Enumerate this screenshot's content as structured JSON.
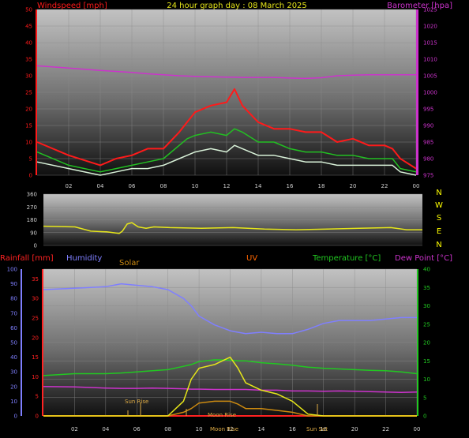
{
  "colors": {
    "background": "#000000",
    "wind_speed": "#ff1a1a",
    "wind_gust": "#22c022",
    "wind_avg": "#d9f2d9",
    "barometer": "#cc33cc",
    "direction": "#e6e61a",
    "rainfall": "#ff2222",
    "humidity": "#7f7fff",
    "solar": "#cc8a10",
    "uv": "#ff6600",
    "temperature": "#21c821",
    "dew_point": "#cc33cc",
    "direction_letters": "#ffff00",
    "astro_labels": "#ddaa44"
  },
  "header": {
    "title": "24 hour graph day : 08 March 2025",
    "wind_label": "Windspeed [mph]",
    "baro_label": "Barometer [hpa]"
  },
  "panel2": {
    "direction_letters": [
      "N",
      "W",
      "S",
      "E",
      "N"
    ]
  },
  "panel3_labels": {
    "rainfall": "Rainfall [mm]",
    "humidity": "Humidity",
    "solar": "Solar",
    "uv": "UV",
    "temperature": "Temperature [°C]",
    "dew_point": "Dew Point [°C]"
  },
  "astro": {
    "sun_rise": "Sun Rise",
    "sun_set": "Sun Set",
    "moon_rise": "Moon Rise",
    "moon_rise_bottom": "Moon Rise"
  },
  "chart_data": [
    {
      "type": "line",
      "x_ticks": [
        "02",
        "04",
        "06",
        "08",
        "10",
        "12",
        "14",
        "16",
        "18",
        "20",
        "22",
        "00"
      ],
      "x_unit": "hour",
      "x": [
        0,
        2,
        4,
        5,
        6,
        7,
        8,
        9,
        9.5,
        10,
        11,
        12,
        12.5,
        13,
        14,
        15,
        16,
        17,
        18,
        19,
        20,
        21,
        22,
        22.5,
        23,
        24
      ],
      "y_left_ticks": [
        "0",
        "5",
        "10",
        "15",
        "20",
        "25",
        "30",
        "35",
        "40",
        "45",
        "50"
      ],
      "ylim_left": [
        0,
        50
      ],
      "y_right_ticks": [
        "975",
        "980",
        "985",
        "990",
        "995",
        "1000",
        "1005",
        "1010",
        "1015",
        "1020",
        "1025"
      ],
      "ylim_right": [
        975,
        1025
      ],
      "series": [
        {
          "name": "Windspeed [mph]",
          "axis": "left",
          "values": [
            10,
            6,
            3,
            5,
            6,
            8,
            8,
            13,
            16,
            19,
            21,
            22,
            26,
            21,
            16,
            14,
            14,
            13,
            13,
            10,
            11,
            9,
            9,
            8,
            5,
            2
          ]
        },
        {
          "axis": "left",
          "values": [
            7,
            3,
            1,
            2,
            3,
            4,
            5,
            9,
            11,
            12,
            13,
            12,
            14,
            13,
            10,
            10,
            8,
            7,
            7,
            6,
            6,
            5,
            5,
            5,
            2,
            1
          ]
        },
        {
          "axis": "left",
          "values": [
            4,
            2,
            0,
            1,
            2,
            2,
            3,
            5,
            6,
            7,
            8,
            7,
            9,
            8,
            6,
            6,
            5,
            4,
            4,
            3,
            3,
            3,
            3,
            3,
            1,
            0
          ]
        },
        {
          "name": "Barometer [hpa]",
          "axis": "right",
          "values": [
            1008,
            1007.3,
            1006.6,
            1006.3,
            1006,
            1005.6,
            1005.3,
            1005,
            1004.9,
            1004.8,
            1004.7,
            1004.6,
            1004.6,
            1004.5,
            1004.5,
            1004.5,
            1004.3,
            1004.2,
            1004.4,
            1005,
            1005.2,
            1005.3,
            1005.3,
            1005.3,
            1005.3,
            1005.3
          ]
        }
      ]
    },
    {
      "type": "line",
      "x": [
        0,
        2,
        3,
        4,
        4.8,
        5,
        5.3,
        5.6,
        6,
        6.5,
        7,
        8,
        10,
        12,
        14,
        16,
        18,
        20,
        22,
        23,
        24
      ],
      "ylim": [
        0,
        360
      ],
      "y_ticks": [
        "0",
        "90",
        "180",
        "270",
        "360"
      ],
      "series": [
        {
          "name": "Wind Direction",
          "values": [
            135,
            130,
            100,
            95,
            85,
            100,
            150,
            160,
            130,
            120,
            130,
            125,
            120,
            125,
            115,
            110,
            115,
            120,
            125,
            110,
            110
          ]
        }
      ]
    },
    {
      "type": "line",
      "x_ticks": [
        "02",
        "04",
        "06",
        "08",
        "10",
        "12",
        "14",
        "16",
        "18",
        "20",
        "22",
        "00"
      ],
      "x_unit": "hour",
      "x": [
        0,
        2,
        4,
        5,
        6,
        7,
        8,
        9,
        9.5,
        10,
        11,
        12,
        12.5,
        13,
        14,
        15,
        16,
        17,
        18,
        19,
        20,
        21,
        22,
        23,
        24
      ],
      "y_humidity_ticks": [
        "0",
        "10",
        "20",
        "30",
        "40",
        "50",
        "60",
        "70",
        "80",
        "90",
        "100"
      ],
      "ylim_humidity": [
        0,
        100
      ],
      "y_rain_ticks": [
        "0",
        "5",
        "10",
        "15",
        "20",
        "25",
        "30",
        "35"
      ],
      "ylim_rain": [
        0,
        37.5
      ],
      "y_temp_ticks": [
        "0",
        "5",
        "10",
        "15",
        "20",
        "25",
        "30",
        "35",
        "40"
      ],
      "ylim_temp": [
        0,
        40
      ],
      "series": [
        {
          "name": "Humidity",
          "axis": "humidity",
          "values": [
            86,
            87,
            88,
            90,
            89,
            88,
            86,
            80,
            75,
            68,
            62,
            58,
            57,
            56,
            57,
            56,
            56,
            59,
            63,
            65,
            65,
            65,
            66,
            67,
            67
          ]
        },
        {
          "name": "Rainfall [mm]",
          "axis": "rain",
          "values": [
            0,
            0,
            0,
            0,
            0,
            0,
            0,
            0,
            0,
            0,
            0,
            0,
            0,
            0,
            0,
            0,
            0,
            0,
            0,
            0,
            0,
            0,
            0,
            0,
            0
          ]
        },
        {
          "name": "Temperature [°C]",
          "axis": "temp",
          "values": [
            11,
            11.5,
            11.5,
            11.7,
            12,
            12.3,
            12.6,
            13.5,
            14,
            14.8,
            15.3,
            15.2,
            15,
            15,
            14.5,
            14.2,
            13.8,
            13.3,
            13,
            12.8,
            12.6,
            12.4,
            12.3,
            12,
            11.5
          ]
        },
        {
          "name": "Dew Point [°C]",
          "axis": "temp",
          "values": [
            8,
            7.9,
            7.6,
            7.5,
            7.5,
            7.6,
            7.5,
            7.4,
            7.3,
            7.3,
            7.2,
            7.2,
            7.2,
            7.2,
            7,
            7,
            6.8,
            6.8,
            6.7,
            6.8,
            6.7,
            6.6,
            6.5,
            6.4,
            6.5
          ]
        },
        {
          "name": "Solar",
          "axis": "temp",
          "values": [
            0,
            0,
            0,
            0,
            0,
            0,
            0,
            1,
            2,
            3.5,
            4,
            4,
            3.2,
            2,
            2,
            1.5,
            1,
            0,
            0,
            0,
            0,
            0,
            0,
            0,
            0
          ]
        },
        {
          "name": "UV",
          "axis": "temp",
          "values": [
            0,
            0,
            0,
            0,
            0,
            0,
            0,
            4,
            10,
            13,
            14,
            16,
            13,
            9,
            7,
            6,
            4,
            0.5,
            0,
            0,
            0,
            0,
            0,
            0,
            0
          ]
        }
      ]
    }
  ]
}
